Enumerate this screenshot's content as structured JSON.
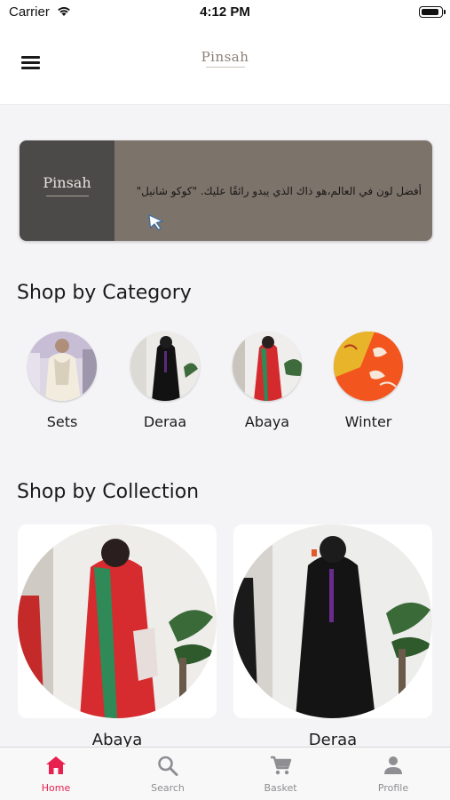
{
  "status_bar": {
    "carrier": "Carrier",
    "time": "4:12 PM"
  },
  "header": {
    "logo_text": "Pinsah",
    "menu_icon": "hamburger-menu-icon"
  },
  "banner": {
    "logo_text": "Pinsah",
    "quote": "أفضل لون في العالم،هو ذاك الذي يبدو رائقًا عليك. \"كوكو شانيل\""
  },
  "shop_by_category": {
    "title": "Shop by Category",
    "items": [
      {
        "label": "Sets"
      },
      {
        "label": "Deraa"
      },
      {
        "label": "Abaya"
      },
      {
        "label": "Winter"
      }
    ]
  },
  "shop_by_collection": {
    "title": "Shop by Collection",
    "items": [
      {
        "label": "Abaya"
      },
      {
        "label": "Deraa"
      }
    ]
  },
  "tab_bar": {
    "tabs": [
      {
        "label": "Home",
        "icon": "home-icon",
        "active": true
      },
      {
        "label": "Search",
        "icon": "search-icon",
        "active": false
      },
      {
        "label": "Basket",
        "icon": "cart-icon",
        "active": false
      },
      {
        "label": "Profile",
        "icon": "person-icon",
        "active": false
      }
    ]
  },
  "colors": {
    "accent": "#e8204f",
    "banner_bg": "#7c736b",
    "banner_logo_bg": "#4c4a48"
  }
}
